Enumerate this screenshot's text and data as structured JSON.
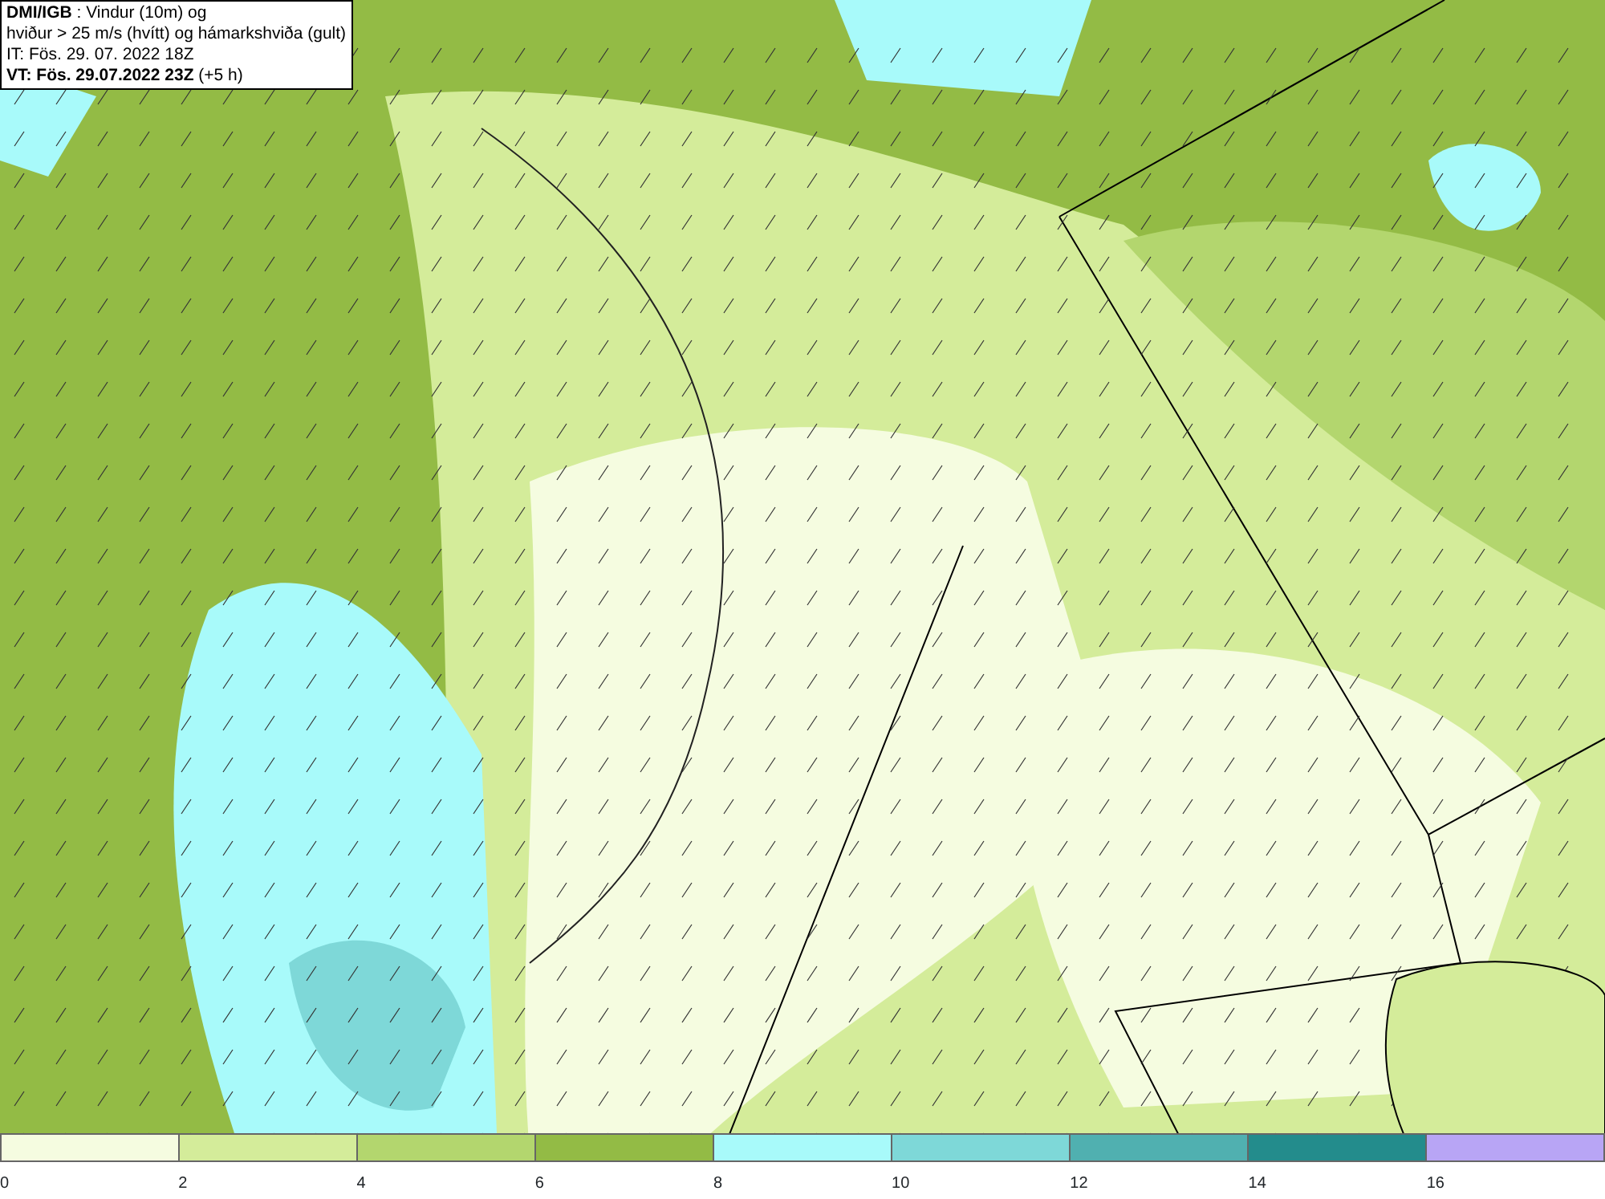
{
  "info_box": {
    "lines": [
      "**DMI/IGB** : Vindur (10m) og",
      "hviður > 25 m/s (hvítt) og hámarkshviða (gult)",
      "IT: Fös. 29. 07. 2022 18Z",
      "**VT: Fös. 29.07.2022 23Z** (+5 h)"
    ]
  },
  "colorbar": [
    {
      "color": "#f5fce0",
      "label": "0"
    },
    {
      "color": "#d4ec9a",
      "label": "2"
    },
    {
      "color": "#b3d66e",
      "label": "4"
    },
    {
      "color": "#93bb45",
      "label": "6"
    },
    {
      "color": "#a8fafa",
      "label": "8"
    },
    {
      "color": "#7ed8d8",
      "label": "10"
    },
    {
      "color": "#50b0b0",
      "label": "12"
    },
    {
      "color": "#238c8c",
      "label": "14"
    },
    {
      "color": "#b8a5f5",
      "label": "16"
    }
  ]
}
